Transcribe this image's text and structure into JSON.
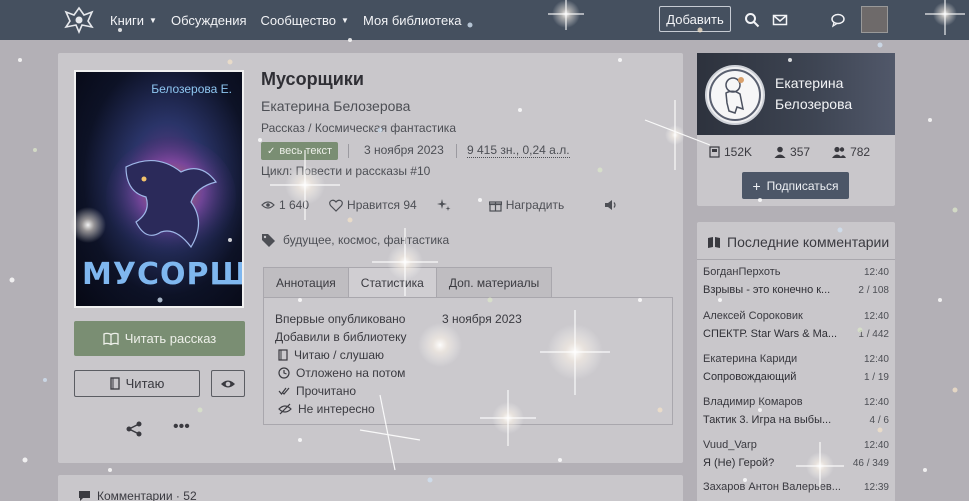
{
  "nav": {
    "items": [
      {
        "label": "Книги",
        "dropdown": true
      },
      {
        "label": "Обсуждения",
        "dropdown": false
      },
      {
        "label": "Сообщество",
        "dropdown": true
      },
      {
        "label": "Моя библиотека",
        "dropdown": false
      }
    ],
    "add_label": "Добавить"
  },
  "book": {
    "cover_author": "Белозерова Е.",
    "cover_title": "МУСОРЩИКИ",
    "title": "Мусорщики",
    "author": "Екатерина Белозерова",
    "genre": "Рассказ / Космическая фантастика",
    "status": "весь текст",
    "date": "3 ноября 2023",
    "size": "9 415 зн., 0,24 а.л.",
    "cycle": "Цикл: Повести и рассказы #10",
    "views": "1 640",
    "likes_label": "Нравится",
    "likes": "94",
    "award_label": "Наградить",
    "tags": "будущее, космос, фантастика",
    "read_label": "Читать рассказ",
    "reading_label": "Читаю"
  },
  "tabs": [
    {
      "label": "Аннотация",
      "active": false
    },
    {
      "label": "Статистика",
      "active": true
    },
    {
      "label": "Доп. материалы",
      "active": false
    }
  ],
  "stats_panel": {
    "first_published_label": "Впервые опубликовано",
    "first_published_value": "3 ноября 2023",
    "added_label": "Добавили в библиотеку",
    "reading": "Читаю / слушаю",
    "later": "Отложено на потом",
    "read": "Прочитано",
    "not_interested": "Не интересно"
  },
  "author_card": {
    "name_line1": "Екатерина",
    "name_line2": "Белозерова",
    "books": "152K",
    "followers": "357",
    "friends": "782",
    "subscribe_label": "Подписаться"
  },
  "recent_comments": {
    "title": "Последние комментарии",
    "items": [
      {
        "name": "БогданПерхоть",
        "time": "12:40",
        "title": "Взрывы - это конечно к...",
        "count": "2 / 108"
      },
      {
        "name": "Алексей Сороковик",
        "time": "12:40",
        "title": "СПЕКТР. Star Wars & Ma...",
        "count": "1 / 442"
      },
      {
        "name": "Екатерина Кариди",
        "time": "12:40",
        "title": "Сопровождающий",
        "count": "1 / 19"
      },
      {
        "name": "Владимир Комаров",
        "time": "12:40",
        "title": "Тактик 3. Игра на выбы...",
        "count": "4 / 6"
      },
      {
        "name": "Vuud_Varp",
        "time": "12:40",
        "title": "Я (Не) Герой?",
        "count": "46 / 349"
      },
      {
        "name": "Захаров Антон Валерьев...",
        "time": "12:39",
        "title": "",
        "count": ""
      }
    ]
  },
  "comments": {
    "label": "Комментарии",
    "count": "52"
  },
  "colors": {
    "topbar": "#45505f",
    "accent_green": "#7a8e73",
    "subscribe": "#4c5667"
  }
}
